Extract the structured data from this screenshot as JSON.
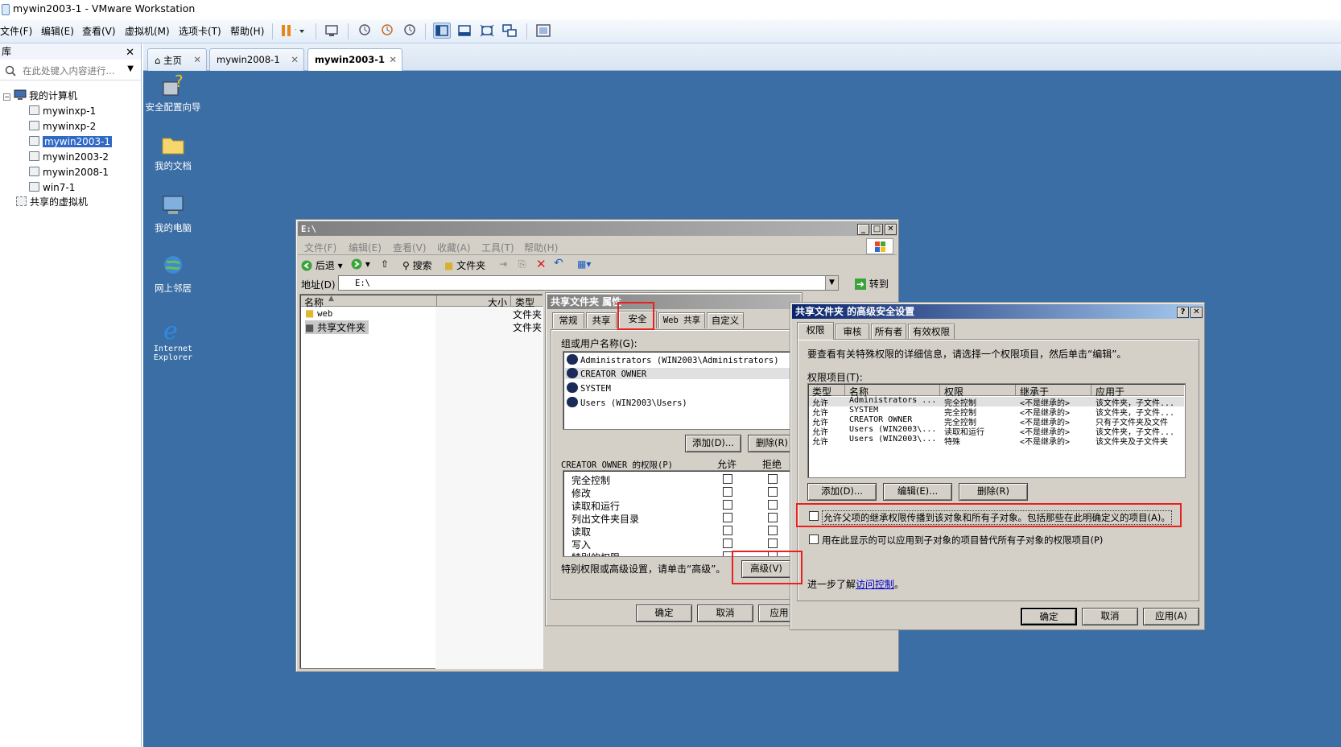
{
  "window": {
    "title": "mywin2003-1 - VMware Workstation"
  },
  "menu": [
    "文件(F)",
    "编辑(E)",
    "查看(V)",
    "虚拟机(M)",
    "选项卡(T)",
    "帮助(H)"
  ],
  "library": {
    "title": "库",
    "search_placeholder": "在此处键入内容进行...",
    "tree": {
      "root": "我的计算机",
      "vms": [
        "mywinxp-1",
        "mywinxp-2",
        "mywin2003-1",
        "mywin2003-2",
        "mywin2008-1",
        "win7-1"
      ],
      "shared": "共享的虚拟机"
    }
  },
  "tabs": [
    "主页",
    "mywin2008-1",
    "mywin2003-1"
  ],
  "desktop": [
    "安全配置向导",
    "我的文档",
    "我的电脑",
    "网上邻居",
    "Internet Explorer"
  ],
  "explorer": {
    "title": "E:\\",
    "menu": [
      "文件(F)",
      "编辑(E)",
      "查看(V)",
      "收藏(A)",
      "工具(T)",
      "帮助(H)"
    ],
    "toolbar": {
      "back": "后退",
      "search": "搜索",
      "folders": "文件夹"
    },
    "address_label": "地址(D)",
    "address_value": "E:\\",
    "go": "转到",
    "columns": [
      "名称",
      "大小",
      "类型"
    ],
    "files": [
      {
        "name": "web",
        "type": "文件夹"
      },
      {
        "name": "共享文件夹",
        "type": "文件夹"
      }
    ]
  },
  "props": {
    "title": "共享文件夹 属性",
    "tabs": [
      "常规",
      "共享",
      "安全",
      "Web 共享",
      "自定义"
    ],
    "group_label": "组或用户名称(G):",
    "users": [
      "Administrators (WIN2003\\Administrators)",
      "CREATOR OWNER",
      "SYSTEM",
      "Users (WIN2003\\Users)"
    ],
    "add": "添加(D)...",
    "remove": "删除(R)",
    "perm_label": "CREATOR OWNER 的权限(P)",
    "allow": "允许",
    "deny": "拒绝",
    "perms": [
      "完全控制",
      "修改",
      "读取和运行",
      "列出文件夹目录",
      "读取",
      "写入",
      "特别的权限"
    ],
    "special_text": "特别权限或高级设置，请单击“高级”。",
    "advanced": "高级(V)",
    "ok": "确定",
    "cancel": "取消",
    "apply": "应用"
  },
  "adv": {
    "title": "共享文件夹 的高级安全设置",
    "tabs": [
      "权限",
      "审核",
      "所有者",
      "有效权限"
    ],
    "desc": "要查看有关特殊权限的详细信息，请选择一个权限项目，然后单击“编辑”。",
    "entries_label": "权限项目(T):",
    "columns": [
      "类型",
      "名称",
      "权限",
      "继承于",
      "应用于"
    ],
    "rows": [
      [
        "允许",
        "Administrators ...",
        "完全控制",
        "<不是继承的>",
        "该文件夹，子文件..."
      ],
      [
        "允许",
        "SYSTEM",
        "完全控制",
        "<不是继承的>",
        "该文件夹，子文件..."
      ],
      [
        "允许",
        "CREATOR OWNER",
        "完全控制",
        "<不是继承的>",
        "只有子文件夹及文件"
      ],
      [
        "允许",
        "Users (WIN2003\\...",
        "读取和运行",
        "<不是继承的>",
        "该文件夹，子文件..."
      ],
      [
        "允许",
        "Users (WIN2003\\...",
        "特殊",
        "<不是继承的>",
        "该文件夹及子文件夹"
      ]
    ],
    "add": "添加(D)...",
    "edit": "编辑(E)...",
    "remove": "删除(R)",
    "inherit": "允许父项的继承权限传播到该对象和所有子对象。包括那些在此明确定义的项目(A)。",
    "replace": "用在此显示的可以应用到子对象的项目替代所有子对象的权限项目(P)",
    "learn_prefix": "进一步了解",
    "learn_link": "访问控制",
    "ok": "确定",
    "cancel": "取消",
    "apply": "应用(A)"
  }
}
